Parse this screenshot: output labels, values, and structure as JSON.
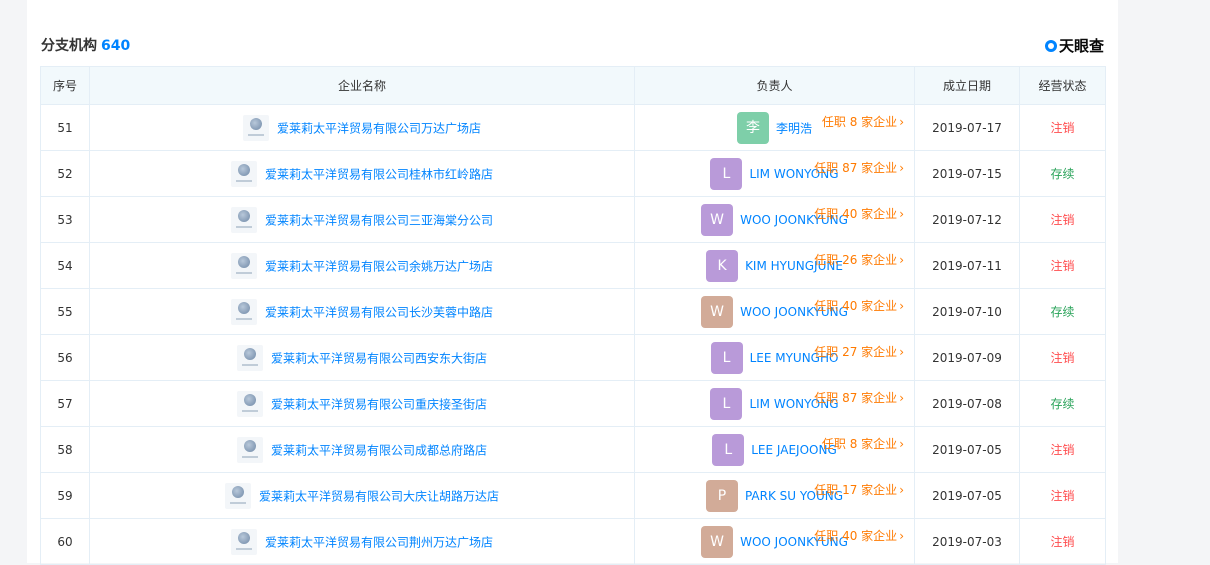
{
  "section": {
    "title": "分支机构",
    "count": "640",
    "brand": "天眼查"
  },
  "colors": {
    "link": "#0084ff",
    "orange": "#ff7a00",
    "cancel": "#ff4d4f",
    "active": "#2aa35a"
  },
  "table": {
    "headers": [
      "序号",
      "企业名称",
      "负责人",
      "成立日期",
      "经营状态"
    ],
    "rows": [
      {
        "idx": "51",
        "company": "爱莱莉太平洋贸易有限公司万达广场店",
        "avatar": "李",
        "avatar_color": "#7ecfa9",
        "person": "李明浩",
        "roles": "任职 8 家企业",
        "date": "2019-07-17",
        "status": "注销",
        "status_type": "cancel"
      },
      {
        "idx": "52",
        "company": "爱莱莉太平洋贸易有限公司桂林市红岭路店",
        "avatar": "L",
        "avatar_color": "#b99ad9",
        "person": "LIM WONYONG",
        "roles": "任职 87 家企业",
        "date": "2019-07-15",
        "status": "存续",
        "status_type": "active"
      },
      {
        "idx": "53",
        "company": "爱莱莉太平洋贸易有限公司三亚海棠分公司",
        "avatar": "W",
        "avatar_color": "#b99ad9",
        "person": "WOO JOONKYUNG",
        "roles": "任职 40 家企业",
        "date": "2019-07-12",
        "status": "注销",
        "status_type": "cancel"
      },
      {
        "idx": "54",
        "company": "爱莱莉太平洋贸易有限公司余姚万达广场店",
        "avatar": "K",
        "avatar_color": "#b99ad9",
        "person": "KIM HYUNGJUNE",
        "roles": "任职 26 家企业",
        "date": "2019-07-11",
        "status": "注销",
        "status_type": "cancel"
      },
      {
        "idx": "55",
        "company": "爱莱莉太平洋贸易有限公司长沙芙蓉中路店",
        "avatar": "W",
        "avatar_color": "#d2ab98",
        "person": "WOO JOONKYUNG",
        "roles": "任职 40 家企业",
        "date": "2019-07-10",
        "status": "存续",
        "status_type": "active"
      },
      {
        "idx": "56",
        "company": "爱莱莉太平洋贸易有限公司西安东大街店",
        "avatar": "L",
        "avatar_color": "#b99ad9",
        "person": "LEE MYUNGHO",
        "roles": "任职 27 家企业",
        "date": "2019-07-09",
        "status": "注销",
        "status_type": "cancel"
      },
      {
        "idx": "57",
        "company": "爱莱莉太平洋贸易有限公司重庆接圣街店",
        "avatar": "L",
        "avatar_color": "#b99ad9",
        "person": "LIM WONYONG",
        "roles": "任职 87 家企业",
        "date": "2019-07-08",
        "status": "存续",
        "status_type": "active"
      },
      {
        "idx": "58",
        "company": "爱莱莉太平洋贸易有限公司成都总府路店",
        "avatar": "L",
        "avatar_color": "#b99ad9",
        "person": "LEE JAEJOONG",
        "roles": "任职 8 家企业",
        "date": "2019-07-05",
        "status": "注销",
        "status_type": "cancel"
      },
      {
        "idx": "59",
        "company": "爱莱莉太平洋贸易有限公司大庆让胡路万达店",
        "avatar": "P",
        "avatar_color": "#d2ab98",
        "person": "PARK SU YOUNG",
        "roles": "任职 17 家企业",
        "date": "2019-07-05",
        "status": "注销",
        "status_type": "cancel"
      },
      {
        "idx": "60",
        "company": "爱莱莉太平洋贸易有限公司荆州万达广场店",
        "avatar": "W",
        "avatar_color": "#d2ab98",
        "person": "WOO JOONKYUNG",
        "roles": "任职 40 家企业",
        "date": "2019-07-03",
        "status": "注销",
        "status_type": "cancel"
      }
    ]
  }
}
